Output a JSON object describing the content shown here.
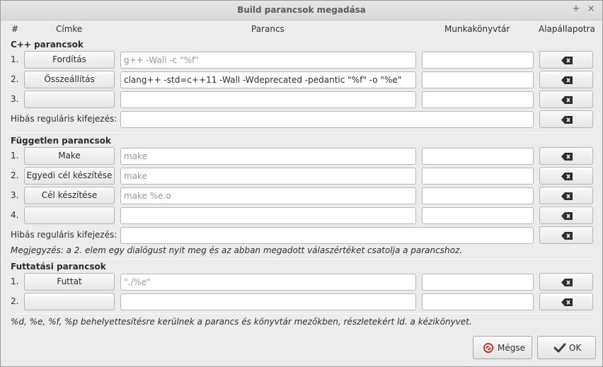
{
  "window": {
    "title": "Build parancsok megadása",
    "pin_icon": "+",
    "close_icon": "×"
  },
  "columns": {
    "num": "#",
    "label": "Címke",
    "command": "Parancs",
    "workdir": "Munkakönyvtár",
    "reset": "Alapállapotra"
  },
  "cpp": {
    "title": "C++ parancsok",
    "rows": [
      {
        "num": "1.",
        "label": "Fordítás",
        "command": "",
        "command_placeholder": "g++ -Wall -c \"%f\"",
        "workdir": ""
      },
      {
        "num": "2.",
        "label": "Összeállítás",
        "command": "clang++ -std=c++11 -Wall -Wdeprecated -pedantic \"%f\" -o \"%e\"",
        "command_placeholder": "",
        "workdir": ""
      },
      {
        "num": "3.",
        "label": "",
        "command": "",
        "command_placeholder": "",
        "workdir": ""
      }
    ],
    "regex_label": "Hibás reguláris kifejezés:",
    "regex_value": ""
  },
  "independent": {
    "title": "Független parancsok",
    "rows": [
      {
        "num": "1.",
        "label": "Make",
        "command": "",
        "command_placeholder": "make",
        "workdir": ""
      },
      {
        "num": "2.",
        "label": "Egyedi cél készítése",
        "command": "",
        "command_placeholder": "make",
        "workdir": ""
      },
      {
        "num": "3.",
        "label": "Cél készítése",
        "command": "",
        "command_placeholder": "make %e.o",
        "workdir": ""
      },
      {
        "num": "4.",
        "label": "",
        "command": "",
        "command_placeholder": "",
        "workdir": ""
      }
    ],
    "regex_label": "Hibás reguláris kifejezés:",
    "regex_value": "",
    "note": "Megjegyzés: a 2. elem egy dialógust nyit meg és az abban megadott válaszértéket csatolja a parancshoz."
  },
  "execute": {
    "title": "Futtatási parancsok",
    "rows": [
      {
        "num": "1.",
        "label": "Futtat",
        "command": "",
        "command_placeholder": "\"./%e\"",
        "workdir": ""
      },
      {
        "num": "2.",
        "label": "",
        "command": "",
        "command_placeholder": "",
        "workdir": ""
      }
    ]
  },
  "footer_note": "%d, %e, %f, %p behelyettesítésre kerülnek a parancs és könyvtár mezőkben, részletekért ld. a kézikönyvet.",
  "buttons": {
    "cancel": "Mégse",
    "ok": "OK",
    "cancel_icon": "cancel-icon",
    "ok_icon": "check-icon"
  },
  "colors": {
    "cancel_icon": "#d0312d",
    "ok_icon": "#3a3a3a",
    "window_bg": "#ececec"
  }
}
